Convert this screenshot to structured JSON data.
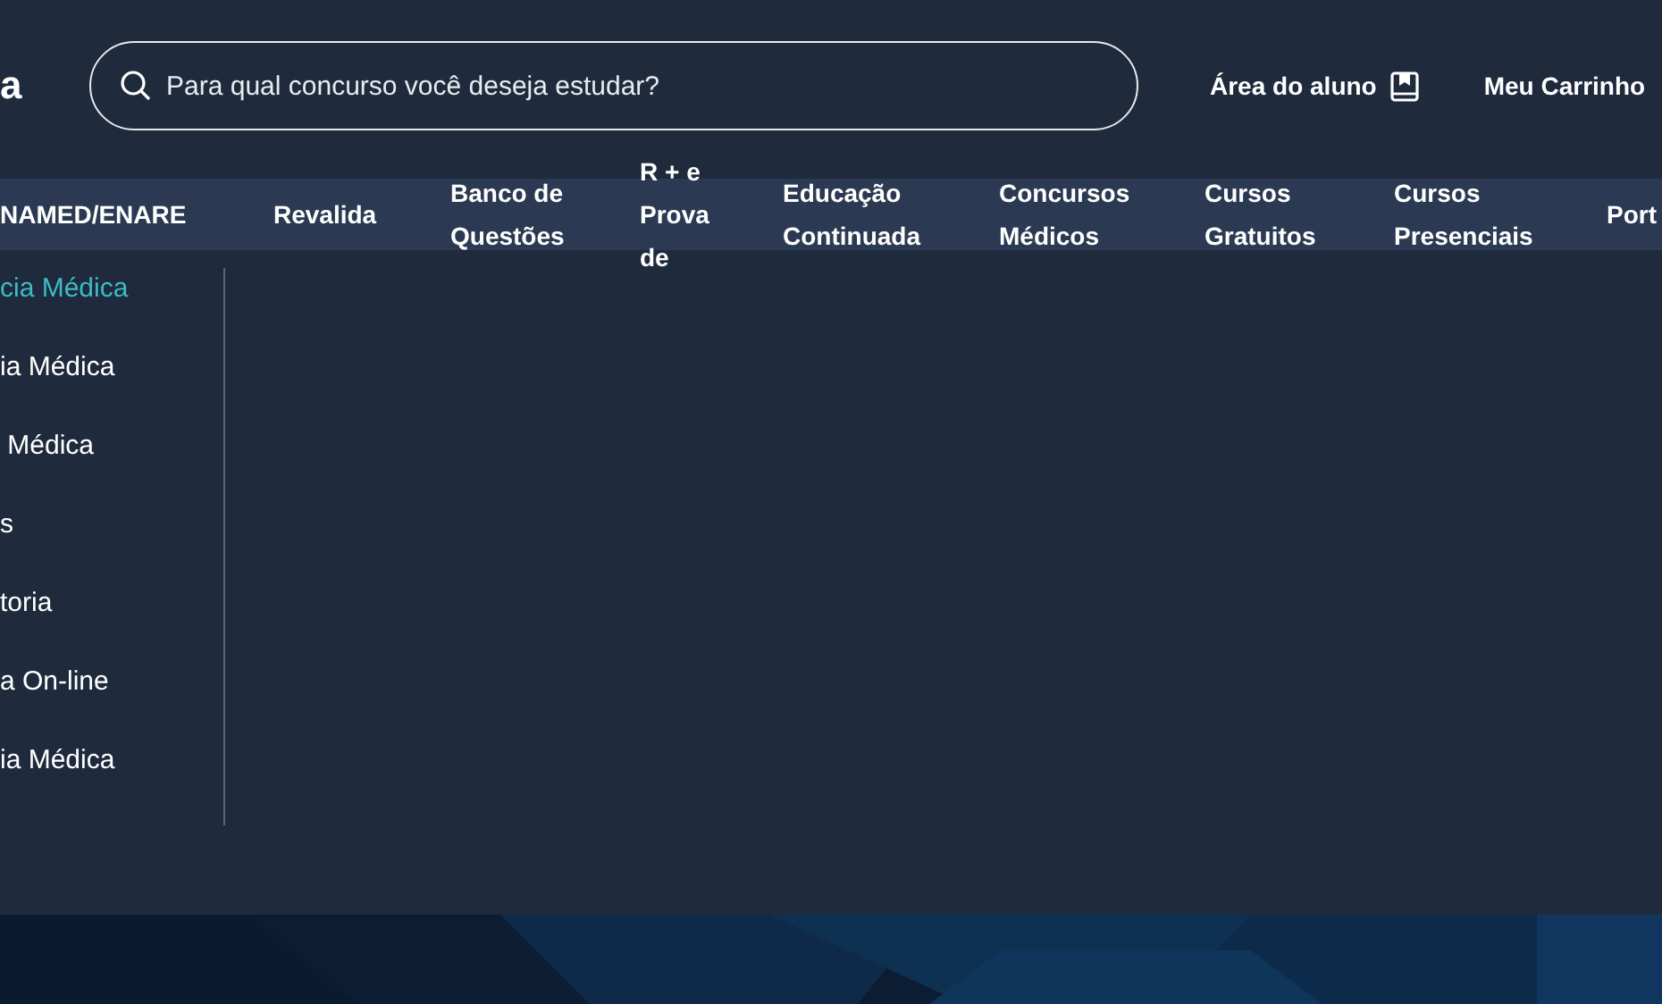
{
  "logo": {
    "text": "a"
  },
  "search": {
    "placeholder": "Para qual concurso você deseja estudar?"
  },
  "header_links": [
    {
      "label": "Área do aluno",
      "kind": "with-icon"
    },
    {
      "label": "Meu Carrinho",
      "kind": "text"
    }
  ],
  "nav": [
    {
      "lines": [
        "NAMED/ENARE"
      ]
    },
    {
      "lines": [
        "Revalida"
      ]
    },
    {
      "lines": [
        "Banco de",
        "Questões"
      ]
    },
    {
      "lines": [
        "R + e",
        "Prova",
        "de"
      ]
    },
    {
      "lines": [
        "Educação",
        "Continuada"
      ]
    },
    {
      "lines": [
        "Concursos",
        "Médicos"
      ]
    },
    {
      "lines": [
        "Cursos",
        "Gratuitos"
      ]
    },
    {
      "lines": [
        "Cursos",
        "Presenciais"
      ]
    },
    {
      "lines": [
        "Port"
      ]
    }
  ],
  "submenu": [
    {
      "label": "cia Médica",
      "selected": true
    },
    {
      "label": "ia Médica",
      "selected": false
    },
    {
      "label": " Médica",
      "selected": false
    },
    {
      "label": "s",
      "selected": false
    },
    {
      "label": "toria",
      "selected": false
    },
    {
      "label": "a On-line",
      "selected": false
    },
    {
      "label": "ia Médica",
      "selected": false
    }
  ]
}
